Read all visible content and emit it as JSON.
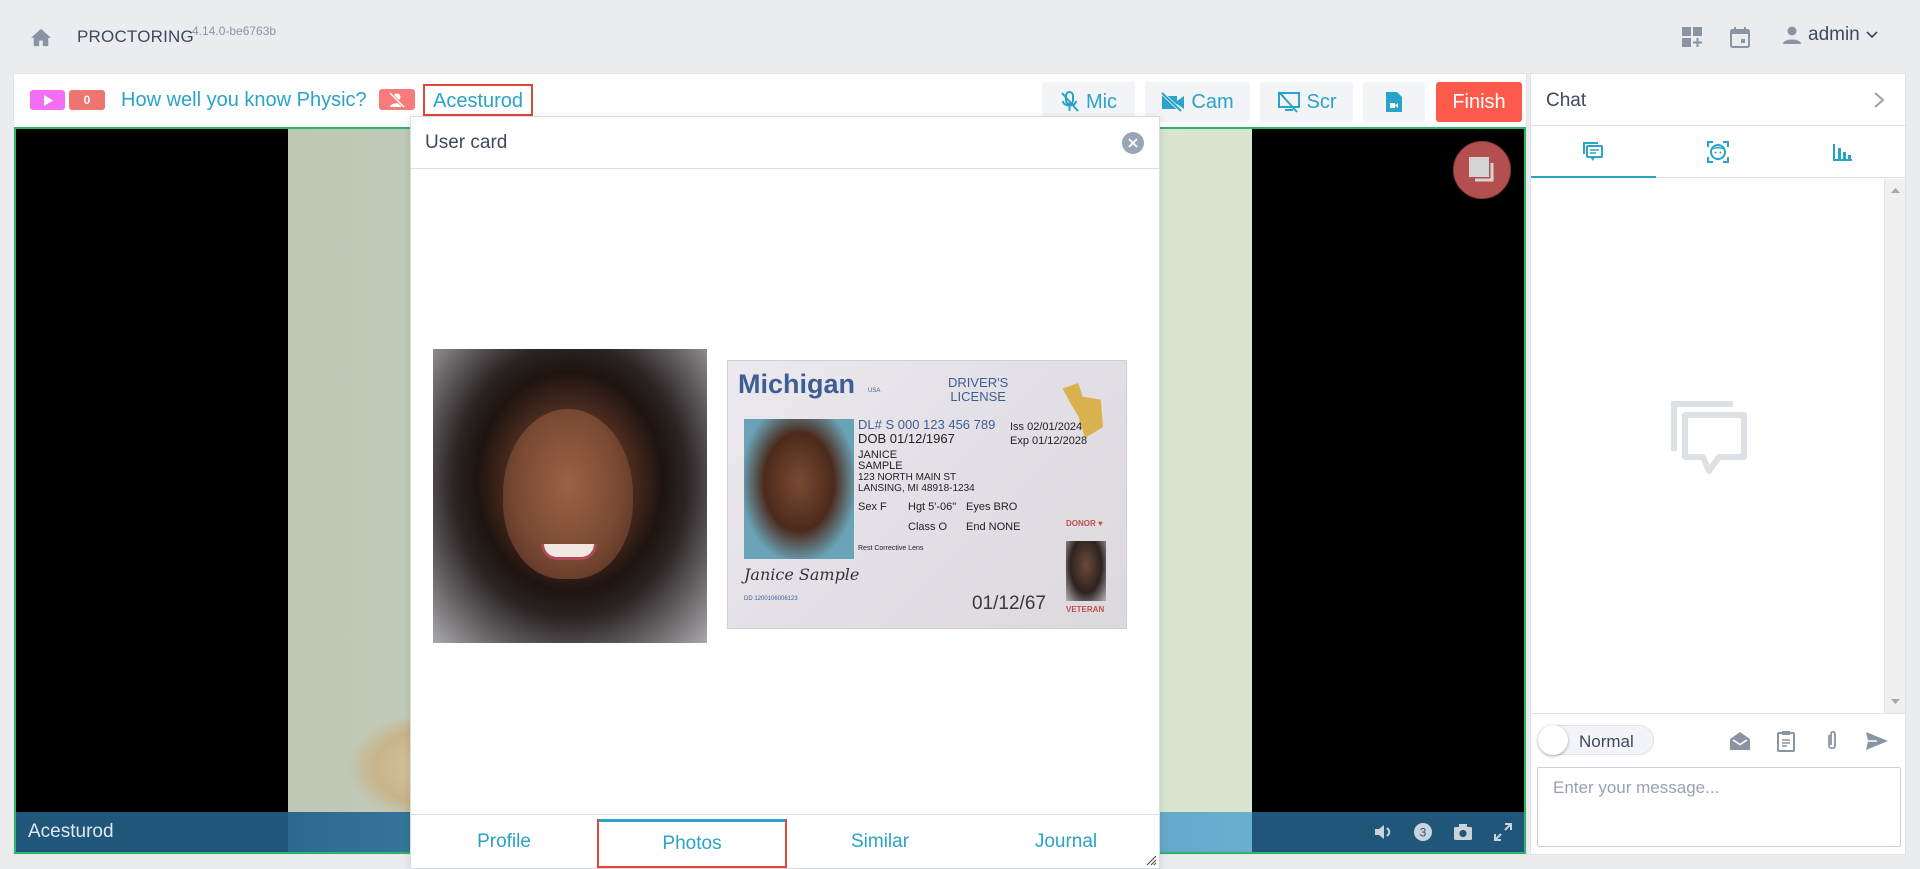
{
  "app": {
    "title": "PROCTORING",
    "version": "4.14.0-be6763b"
  },
  "header": {
    "user_label": "admin",
    "icons": [
      "home-icon",
      "dashboard-add-icon",
      "calendar-icon",
      "user-icon",
      "chevron-down-icon"
    ]
  },
  "session": {
    "count_badge": "0",
    "exam_title": "How well you know Physic?",
    "user_name": "Acesturod",
    "buttons": {
      "mic": "Mic",
      "cam": "Cam",
      "scr": "Scr",
      "finish": "Finish"
    },
    "video_user": "Acesturod",
    "video_controls": [
      "volume-icon",
      "count-3-icon",
      "camera-icon",
      "fullscreen-icon"
    ],
    "video_count": "3"
  },
  "user_card": {
    "title": "User card",
    "tabs": [
      {
        "label": "Profile",
        "active": false
      },
      {
        "label": "Photos",
        "active": true
      },
      {
        "label": "Similar",
        "active": false
      },
      {
        "label": "Journal",
        "active": false
      }
    ],
    "id_document": {
      "state": "Michigan",
      "country": "USA",
      "type_line1": "DRIVER'S",
      "type_line2": "LICENSE",
      "dl_number": "DL# S 000 123 456 789",
      "dob": "DOB 01/12/1967",
      "iss": "Iss 02/01/2024",
      "exp": "Exp 01/12/2028",
      "name_line1": "JANICE",
      "name_line2": "SAMPLE",
      "address1": "123 NORTH MAIN ST",
      "address2": "LANSING, MI 48918-1234",
      "sex": "Sex F",
      "hgt": "Hgt 5'-06\"",
      "eyes": "Eyes BRO",
      "class": "Class O",
      "end": "End NONE",
      "rest": "Rest Corrective Lens",
      "signature": "Janice Sample",
      "dd": "DD 1200106006123",
      "date_bottom": "01/12/67",
      "donor": "DONOR ♥",
      "veteran": "VETERAN"
    }
  },
  "chat": {
    "title": "Chat",
    "tabs": [
      {
        "name": "messages",
        "active": true
      },
      {
        "name": "face",
        "active": false
      },
      {
        "name": "stats",
        "active": false
      }
    ],
    "mode_toggle_label": "Normal",
    "input_placeholder": "Enter your message...",
    "input_value": ""
  },
  "colors": {
    "accent": "#29a3c7",
    "finish": "#fd5a4b",
    "video_border": "#2db56a",
    "highlight_box": "#e2453b",
    "play_badge": "#f36ef5",
    "count_badge": "#ef7570"
  }
}
